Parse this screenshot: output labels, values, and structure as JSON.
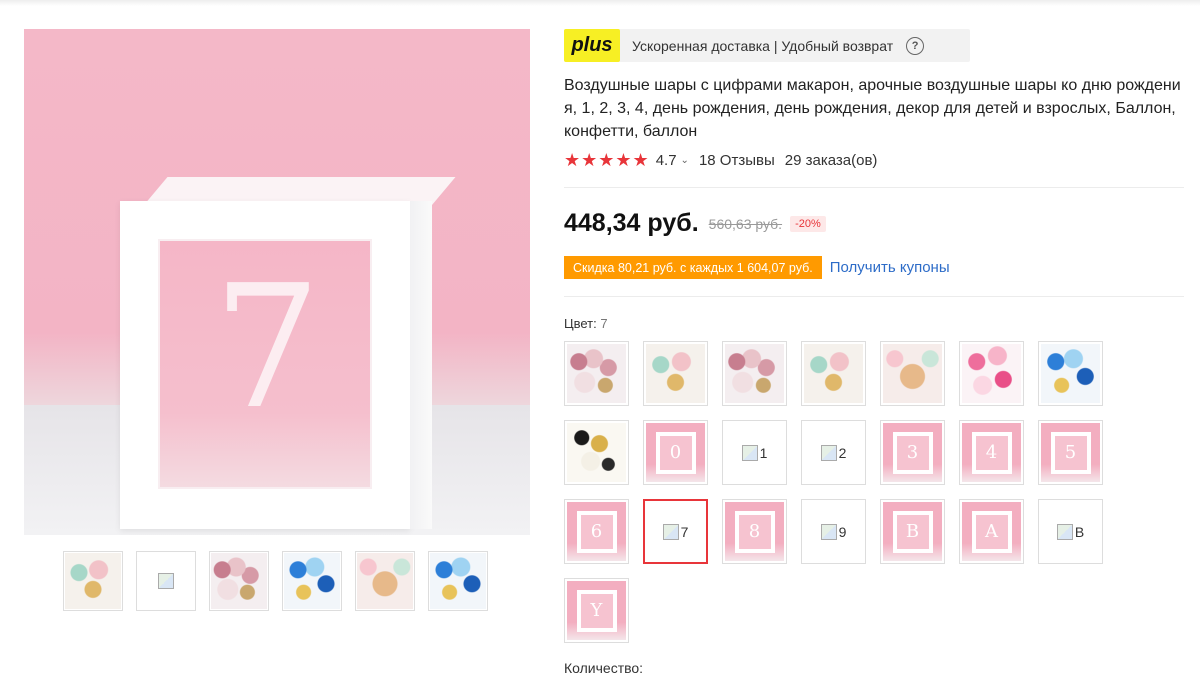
{
  "plus": {
    "logo": "plus",
    "text": "Ускоренная доставка | Удобный возврат",
    "help": "?"
  },
  "product": {
    "title": "Воздушные шары с цифрами макарон, арочные воздушные шары ко дню рождения, 1, 2, 3, 4, день рождения, день рождения, декор для детей и взрослых, Баллон, конфетти, баллон",
    "main_image_digit": "7",
    "stars": "★★★★★",
    "rating": "4.7",
    "reviews": "18 Отзывы",
    "orders": "29 заказа(ов)"
  },
  "price": {
    "current": "448,34 руб.",
    "old": "560,63 руб.",
    "discount": "-20%"
  },
  "coupon": {
    "badge": "Скидка 80,21 руб. с каждых 1 604,07 руб.",
    "link": "Получить купоны"
  },
  "color": {
    "label": "Цвет:",
    "selected": "7",
    "options": [
      {
        "kind": "image",
        "style": "balloon-pic"
      },
      {
        "kind": "image",
        "style": "balloon-mixed"
      },
      {
        "kind": "image",
        "style": "balloon-pic"
      },
      {
        "kind": "image",
        "style": "balloon-mixed"
      },
      {
        "kind": "image",
        "style": "balloon-frame"
      },
      {
        "kind": "image",
        "style": "balloon-pink"
      },
      {
        "kind": "image",
        "style": "balloon-blue"
      },
      {
        "kind": "image",
        "style": "balloon-gold"
      },
      {
        "kind": "box",
        "char": "0"
      },
      {
        "kind": "broken",
        "alt": "1"
      },
      {
        "kind": "broken",
        "alt": "2"
      },
      {
        "kind": "box",
        "char": "3"
      },
      {
        "kind": "box",
        "char": "4"
      },
      {
        "kind": "box",
        "char": "5"
      },
      {
        "kind": "box",
        "char": "6"
      },
      {
        "kind": "broken",
        "alt": "7",
        "selected": true
      },
      {
        "kind": "box",
        "char": "8"
      },
      {
        "kind": "broken",
        "alt": "9"
      },
      {
        "kind": "box",
        "char": "B"
      },
      {
        "kind": "box",
        "char": "A"
      },
      {
        "kind": "broken",
        "alt": "B"
      },
      {
        "kind": "box",
        "char": "Y"
      }
    ]
  },
  "thumbnails": [
    {
      "kind": "image",
      "style": "balloon-mixed"
    },
    {
      "kind": "broken"
    },
    {
      "kind": "image",
      "style": "balloon-pic"
    },
    {
      "kind": "image",
      "style": "balloon-blue"
    },
    {
      "kind": "image",
      "style": "balloon-frame"
    },
    {
      "kind": "image",
      "style": "balloon-blue"
    }
  ],
  "quantity": {
    "label": "Количество:"
  },
  "colors": {
    "accent_red": "#e8353a",
    "coupon_orange": "#ff9a00",
    "link_blue": "#2d6cc8",
    "plus_yellow": "#f7ef24"
  }
}
